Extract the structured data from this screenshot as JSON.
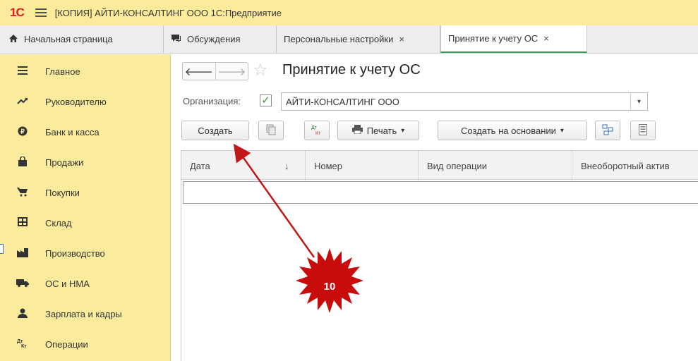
{
  "window": {
    "logo": "1С",
    "title": "[КОПИЯ] АЙТИ-КОНСАЛТИНГ ООО 1С:Предприятие"
  },
  "tabs": [
    {
      "label": "Начальная страница",
      "icon": "home-icon"
    },
    {
      "label": "Обсуждения",
      "icon": "chat-icon"
    },
    {
      "label": "Персональные настройки",
      "closable": true
    },
    {
      "label": "Принятие к учету ОС",
      "closable": true,
      "active": true
    }
  ],
  "tab_close_glyph": "×",
  "sidebar": {
    "items": [
      {
        "label": "Главное",
        "icon": "list-icon"
      },
      {
        "label": "Руководителю",
        "icon": "chart-trend-icon"
      },
      {
        "label": "Банк и касса",
        "icon": "coin-icon"
      },
      {
        "label": "Продажи",
        "icon": "bag-icon"
      },
      {
        "label": "Покупки",
        "icon": "cart-icon"
      },
      {
        "label": "Склад",
        "icon": "warehouse-icon"
      },
      {
        "label": "Производство",
        "icon": "factory-icon"
      },
      {
        "label": "ОС и НМА",
        "icon": "truck-icon"
      },
      {
        "label": "Зарплата и кадры",
        "icon": "person-icon"
      },
      {
        "label": "Операции",
        "icon": "dt-kt-icon"
      }
    ],
    "background": "#fbec9d"
  },
  "page": {
    "title": "Принятие к учету ОС",
    "org_label": "Организация:",
    "org_checked": true,
    "org_value": "АЙТИ-КОНСАЛТИНГ ООО"
  },
  "toolbar": {
    "create_label": "Создать",
    "dtkt_label": "Дт\nКт",
    "print_label": "Печать",
    "create_based_label": "Создать на основании"
  },
  "table": {
    "columns": [
      "Дата",
      "↓",
      "Номер",
      "Вид операции",
      "Внеоборотный актив"
    ]
  },
  "annotation": {
    "badge_number": "10",
    "badge_color": "#c80b0b",
    "arrow_color": "#c01818"
  },
  "colors": {
    "titlebar": "#fbeb9b",
    "active_tab_underline": "#3f9c5a",
    "logo": "#e21d1d"
  }
}
